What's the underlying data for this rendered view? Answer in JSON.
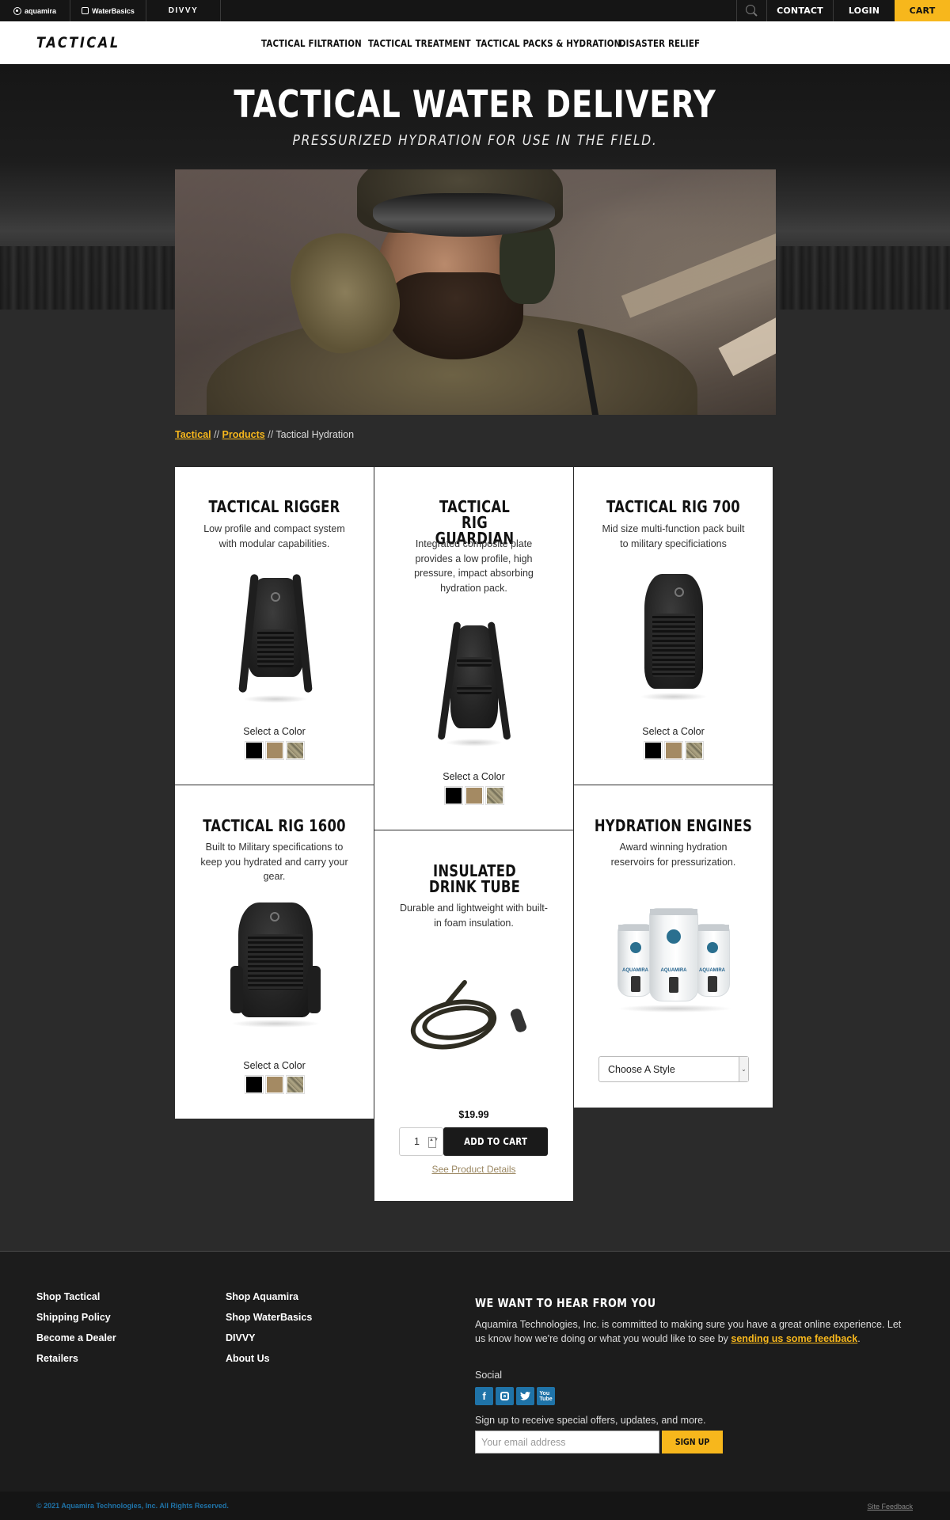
{
  "topbar": {
    "brands": [
      "aquamira",
      "WaterBasics",
      "DIVVY"
    ],
    "links": {
      "contact": "CONTACT",
      "login": "LOGIN",
      "cart": "CART"
    }
  },
  "nav": {
    "logo": "TACTICAL",
    "items": [
      "TACTICAL FILTRATION",
      "TACTICAL TREATMENT",
      "TACTICAL PACKS & HYDRATION",
      "DISASTER RELIEF"
    ]
  },
  "hero": {
    "title": "TACTICAL WATER DELIVERY",
    "subtitle": "PRESSURIZED HYDRATION FOR USE IN THE FIELD."
  },
  "breadcrumb": {
    "items": [
      "Tactical",
      "Products",
      "Tactical Hydration"
    ],
    "separator": "//"
  },
  "products": [
    {
      "title": "TACTICAL RIGGER",
      "desc": "Low profile and compact system with modular capabilities.",
      "color_label": "Select a Color"
    },
    {
      "title": "TACTICAL RIG GUARDIAN",
      "desc": "Integrated composite plate provides a low profile, high pressure, impact absorbing hydration pack.",
      "color_label": "Select a Color"
    },
    {
      "title": "TACTICAL RIG 700",
      "desc": "Mid size multi-function pack built to military specificiations",
      "color_label": "Select a Color"
    },
    {
      "title": "TACTICAL RIG 1600",
      "desc": "Built to Military specifications to keep you hydrated and carry your gear.",
      "color_label": "Select a Color"
    },
    {
      "title": "INSULATED DRINK TUBE",
      "desc": "Durable and lightweight with built-in foam insulation.",
      "price": "$19.99",
      "qty": "1",
      "add_to_cart": "ADD TO CART",
      "details": "See Product Details"
    },
    {
      "title": "HYDRATION ENGINES",
      "desc": "Award winning hydration reservoirs for pressurization.",
      "select_placeholder": "Choose A Style"
    }
  ],
  "swatch_colors": {
    "black": "#000000",
    "tan": "#a48a63",
    "camo": "multicam"
  },
  "footer": {
    "col1": [
      "Shop Tactical",
      "Shipping Policy",
      "Become a Dealer",
      "Retailers"
    ],
    "col2": [
      "Shop Aquamira",
      "Shop WaterBasics",
      "DIVVY",
      "About Us"
    ],
    "heading": "WE WANT TO HEAR FROM YOU",
    "text1": "Aquamira Technologies, Inc. is committed to making sure you have a great online experience. Let us know how we're doing or what you would like to see by ",
    "link": "sending us some feedback",
    "text2": ".",
    "social_label": "Social",
    "social": [
      "f",
      "ig",
      "t",
      "yt"
    ],
    "signup_label": "Sign up to receive special offers, updates, and more.",
    "email_placeholder": "Your email address",
    "signup_button": "SIGN UP",
    "copyright": "© 2021 Aquamira Technologies, Inc. All Rights Reserved.",
    "site_feedback": "Site Feedback"
  },
  "colors": {
    "accent": "#f7b71c",
    "dark": "#151515",
    "social_blue": "#1f73a8"
  }
}
